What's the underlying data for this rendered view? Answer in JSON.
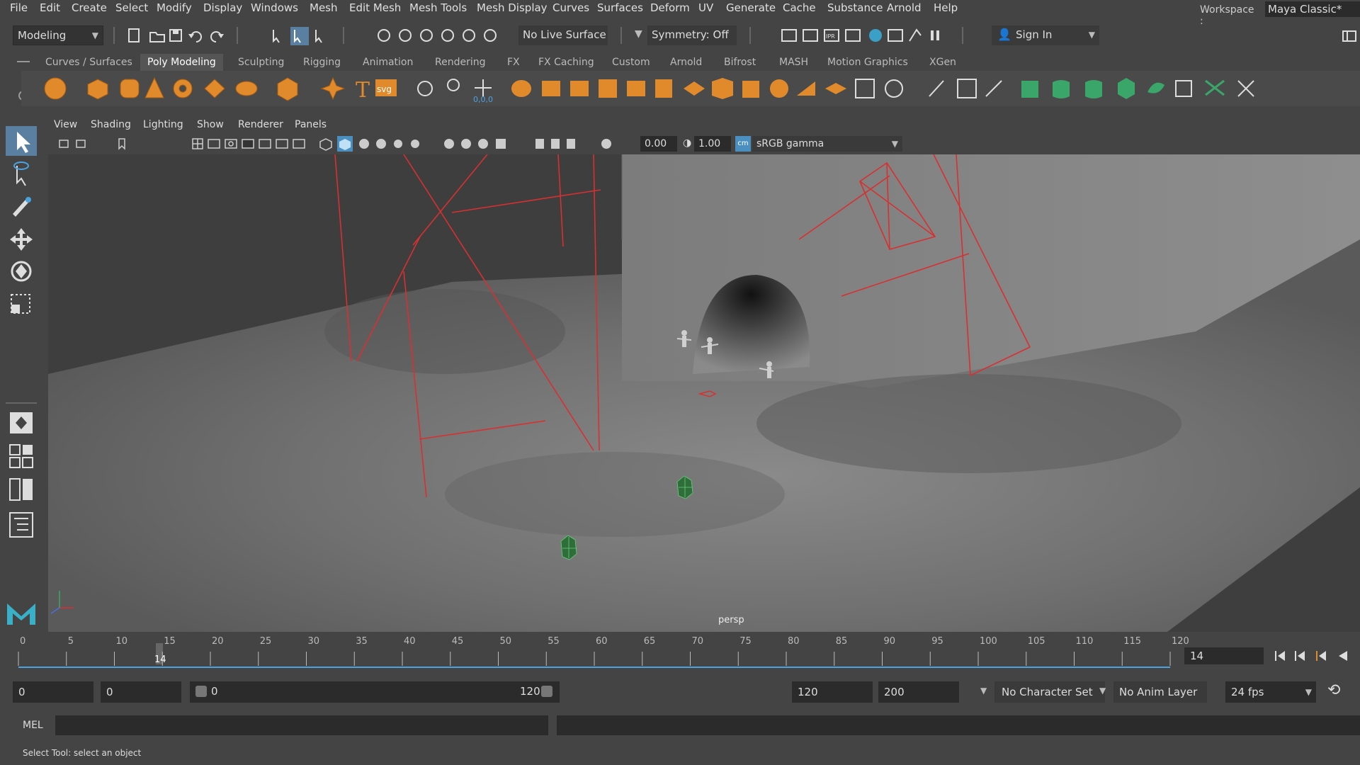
{
  "menu": {
    "items": [
      "File",
      "Edit",
      "Create",
      "Select",
      "Modify",
      "Display",
      "Windows",
      "Mesh",
      "Edit Mesh",
      "Mesh Tools",
      "Mesh Display",
      "Curves",
      "Surfaces",
      "Deform",
      "UV",
      "Generate",
      "Cache",
      "Substance",
      "Arnold",
      "Help"
    ],
    "workspace_label": "Workspace :",
    "workspace_value": "Maya Classic*"
  },
  "status": {
    "mode": "Modeling",
    "live_surface": "No Live Surface",
    "symmetry": "Symmetry: Off",
    "sign_in": "Sign In"
  },
  "shelf": {
    "tabs": [
      "Curves / Surfaces",
      "Poly Modeling",
      "Sculpting",
      "Rigging",
      "Animation",
      "Rendering",
      "FX",
      "FX Caching",
      "Custom",
      "Arnold",
      "Bifrost",
      "MASH",
      "Motion Graphics",
      "XGen"
    ],
    "active_tab": "Poly Modeling",
    "svg_label": "svg",
    "coord_label": "0,0,0"
  },
  "panel": {
    "menus": [
      "View",
      "Shading",
      "Lighting",
      "Show",
      "Renderer",
      "Panels"
    ],
    "exposure": "0.00",
    "gamma": "1.00",
    "colorspace": "sRGB gamma",
    "camera": "persp"
  },
  "timeline": {
    "ticks": [
      "0",
      "5",
      "10",
      "15",
      "20",
      "25",
      "30",
      "35",
      "40",
      "45",
      "50",
      "55",
      "60",
      "65",
      "70",
      "75",
      "80",
      "85",
      "90",
      "95",
      "100",
      "105",
      "110",
      "115",
      "120"
    ],
    "current_frame": "14",
    "current_frame_field": "14"
  },
  "range": {
    "start": "0",
    "playback_start": "0",
    "slider_start": "0",
    "slider_end": "120",
    "playback_end": "120",
    "end": "200",
    "character_set": "No Character Set",
    "anim_layer": "No Anim Layer",
    "fps": "24 fps"
  },
  "command": {
    "lang": "MEL"
  },
  "help": {
    "text": "Select Tool: select an object"
  },
  "colors": {
    "accent_orange": "#e08a2c",
    "accent_green": "#3aa66a",
    "accent_blue": "#4aa3df",
    "wire_red": "#d83030"
  }
}
